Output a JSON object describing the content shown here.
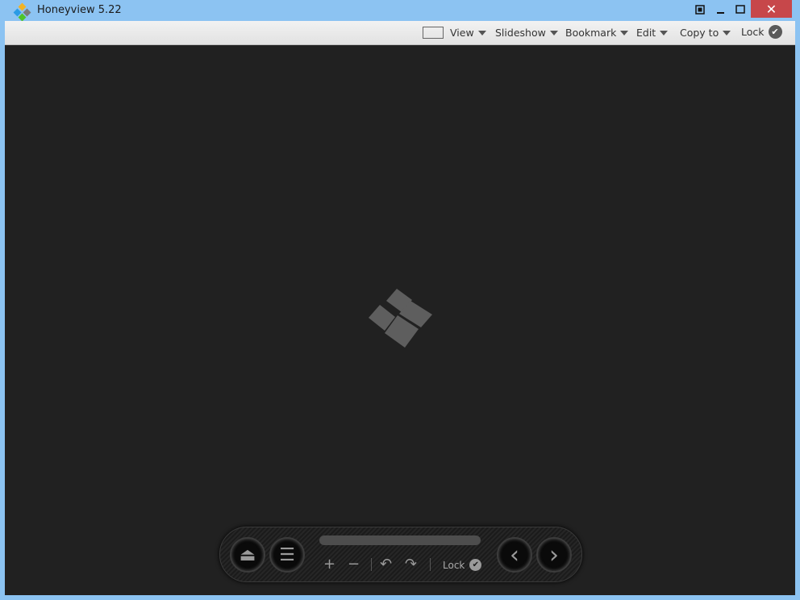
{
  "window": {
    "title": "Honeyview 5.22",
    "close_label": "✕"
  },
  "menu": {
    "items": [
      {
        "label": "View"
      },
      {
        "label": "Slideshow"
      },
      {
        "label": "Bookmark"
      },
      {
        "label": "Edit"
      },
      {
        "label": "Copy to"
      },
      {
        "label": "Lock"
      }
    ]
  },
  "controls": {
    "eject_glyph": "⏏",
    "menu_glyph": "☰",
    "zoom_in": "+",
    "zoom_out": "−",
    "rotate_left": "↶",
    "rotate_right": "↷",
    "lock_label": "Lock",
    "prev": "‹",
    "next": "›",
    "check": "✔"
  }
}
